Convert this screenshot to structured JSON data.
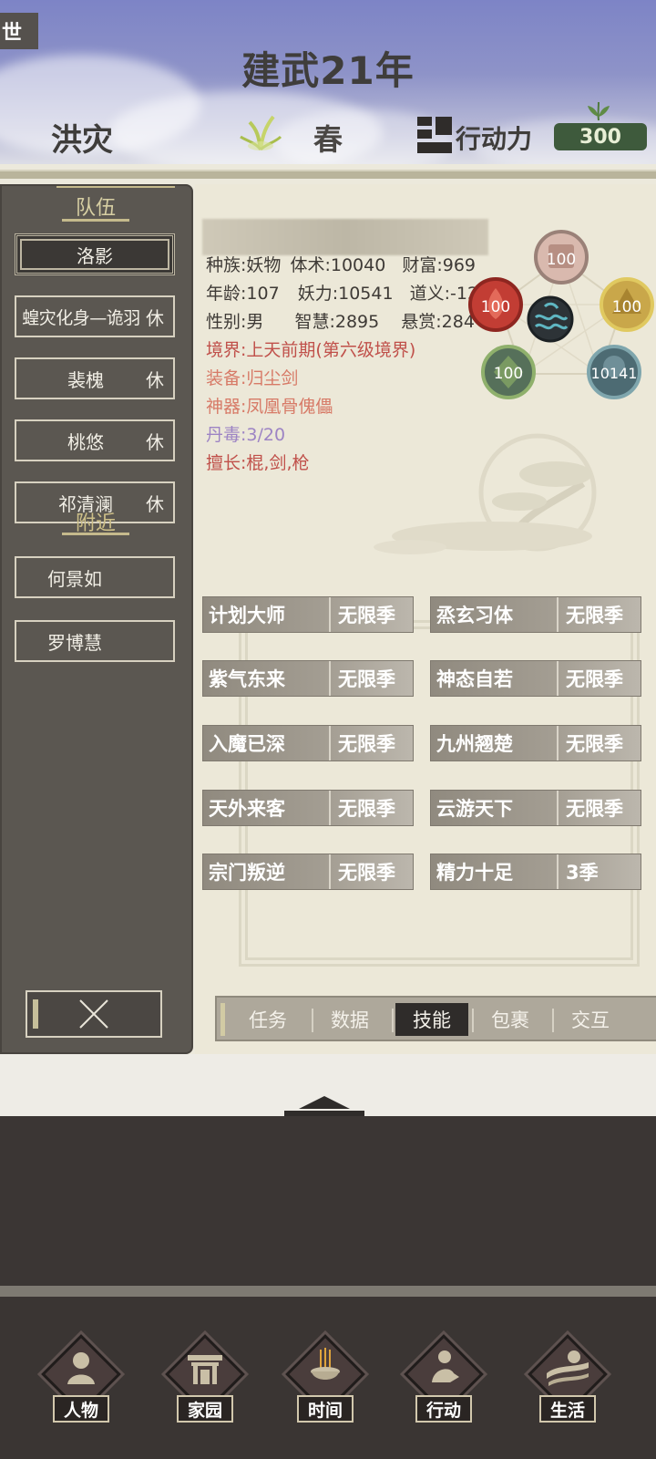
{
  "header": {
    "corner_tab": "世",
    "year_title": "建武21年",
    "disaster": "洪灾",
    "season": "春",
    "action_label": "行动力",
    "action_points": "300"
  },
  "sidebar": {
    "team_title": "队伍",
    "nearby_title": "附近",
    "team": [
      {
        "name": "洛影",
        "status": "",
        "selected": true
      },
      {
        "name": "蝗灾化身—诡羽",
        "status": "休"
      },
      {
        "name": "裴槐",
        "status": "休"
      },
      {
        "name": "桃悠",
        "status": "休"
      },
      {
        "name": "祁清澜",
        "status": "休"
      }
    ],
    "nearby": [
      {
        "name": "何景如"
      },
      {
        "name": "罗博慧"
      }
    ],
    "close_icon": "close-x-icon"
  },
  "character": {
    "race": "种族:妖物",
    "body_art": "体术:10040",
    "wealth": "财富:969",
    "age": "年龄:107",
    "demon_power": "妖力:10541",
    "righteousness": "道义:-12846",
    "gender": "性别:男",
    "wisdom": "智慧:2895",
    "bounty": "悬赏:284",
    "realm": "境界:上天前期(第六级境界)",
    "equipment": "装备:归尘剑",
    "artifact": "神器:凤凰骨傀儡",
    "poison": "丹毒:3/20",
    "specialty": "擅长:棍,剑,枪"
  },
  "elements": {
    "top": "100",
    "left": "100",
    "right": "100",
    "bottom_left": "100",
    "bottom_right": "10141",
    "center_icon": "water-icon"
  },
  "skills": [
    {
      "name": "计划大师",
      "duration": "无限季"
    },
    {
      "name": "烝玄习体",
      "duration": "无限季"
    },
    {
      "name": "紫气东来",
      "duration": "无限季"
    },
    {
      "name": "神态自若",
      "duration": "无限季"
    },
    {
      "name": "入魔已深",
      "duration": "无限季"
    },
    {
      "name": "九州翘楚",
      "duration": "无限季"
    },
    {
      "name": "天外来客",
      "duration": "无限季"
    },
    {
      "name": "云游天下",
      "duration": "无限季"
    },
    {
      "name": "宗门叛逆",
      "duration": "无限季"
    },
    {
      "name": "精力十足",
      "duration": "3季"
    }
  ],
  "tabs": [
    "任务",
    "数据",
    "技能",
    "包裹",
    "交互"
  ],
  "active_tab": "技能",
  "nav": [
    {
      "label": "人物",
      "icon": "person-icon"
    },
    {
      "label": "家园",
      "icon": "home-gate-icon"
    },
    {
      "label": "时间",
      "icon": "incense-burner-icon"
    },
    {
      "label": "行动",
      "icon": "action-figure-icon"
    },
    {
      "label": "生活",
      "icon": "landscape-sun-icon"
    }
  ],
  "colors": {
    "sidebar_bg": "#5b5751",
    "panel_bg": "#ece8d8",
    "realm_red": "#c0504a",
    "equip_orange": "#d77a67",
    "poison_purple": "#9d84c4",
    "ap_green": "#3e5a3c"
  }
}
